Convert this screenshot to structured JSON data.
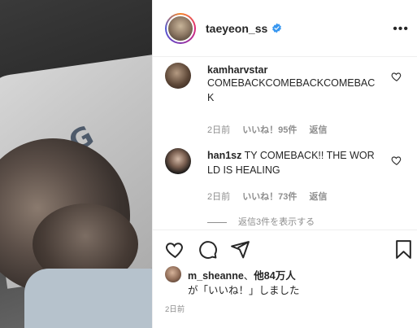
{
  "post": {
    "username": "taeyeon_ss",
    "verified": true,
    "more_icon": "more-horizontal-icon",
    "timestamp": "2日前"
  },
  "comments": [
    {
      "username": "kamharvstar",
      "text": "COMEBACKCOMEBACKCOMEBACK",
      "time": "2日前",
      "likes": "いいね！95件",
      "reply_label": "返信"
    },
    {
      "username": "han1sz",
      "text": "TY COMEBACK!! THE WORLD IS HEALING",
      "time": "2日前",
      "likes": "いいね！73件",
      "reply_label": "返信"
    }
  ],
  "view_replies": "返信3件を表示する",
  "likes": {
    "user": "m_sheanne",
    "others": "他84万人",
    "suffix": "が「いいね！」しました"
  },
  "colors": {
    "text": "#262626",
    "secondary": "#8e8e8e",
    "verified": "#3897f0",
    "divider": "#efefef"
  }
}
